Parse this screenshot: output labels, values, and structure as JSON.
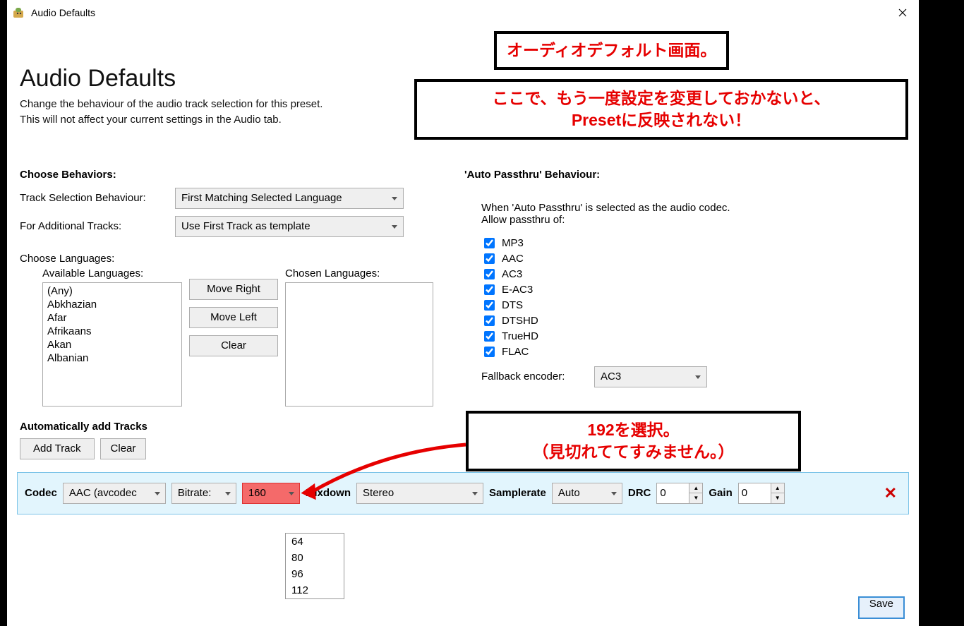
{
  "window": {
    "title": "Audio Defaults"
  },
  "header": {
    "heading": "Audio Defaults",
    "desc1": "Change the behaviour of the audio track selection for this preset.",
    "desc2": "This will not affect your current settings in the Audio tab."
  },
  "behaviors": {
    "section": "Choose Behaviors:",
    "track_sel_label": "Track Selection Behaviour:",
    "track_sel_value": "First Matching Selected Language",
    "additional_label": "For Additional Tracks:",
    "additional_value": "Use First Track as template"
  },
  "languages": {
    "section": "Choose Languages:",
    "available_label": "Available Languages:",
    "chosen_label": "Chosen Languages:",
    "items": [
      "(Any)",
      "Abkhazian",
      "Afar",
      "Afrikaans",
      "Akan",
      "Albanian"
    ],
    "move_right": "Move Right",
    "move_left": "Move Left",
    "clear": "Clear"
  },
  "passthru": {
    "section": "'Auto Passthru' Behaviour:",
    "desc1": "When 'Auto Passthru' is selected as the audio codec.",
    "desc2": "Allow passthru of:",
    "items": [
      "MP3",
      "AAC",
      "AC3",
      "E-AC3",
      "DTS",
      "DTSHD",
      "TrueHD",
      "FLAC"
    ],
    "fallback_label": "Fallback encoder:",
    "fallback_value": "AC3"
  },
  "auto_tracks": {
    "section": "Automatically add Tracks",
    "add": "Add Track",
    "clear": "Clear"
  },
  "track": {
    "codec_label": "Codec",
    "codec_value": "AAC (avcodec",
    "bitrate_label": "Bitrate:",
    "bitrate_value": "160",
    "mixdown_label": "Mixdown",
    "mixdown_value": "Stereo",
    "sample_label": "Samplerate",
    "sample_value": "Auto",
    "drc_label": "DRC",
    "drc_value": "0",
    "gain_label": "Gain",
    "gain_value": "0",
    "options": [
      "64",
      "80",
      "96",
      "112"
    ]
  },
  "footer": {
    "save": "Save"
  },
  "callouts": {
    "c1": "オーディオデフォルト画面。",
    "c2a": "ここで、もう一度設定を変更しておかないと、",
    "c2b": "Presetに反映されない！",
    "c3a": "192を選択。",
    "c3b": "（見切れててすみません。）"
  }
}
